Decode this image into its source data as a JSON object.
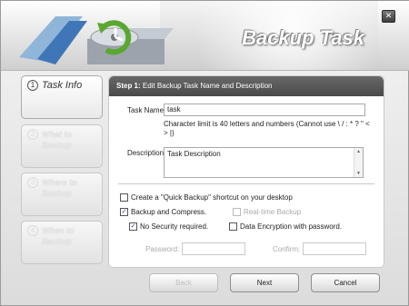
{
  "window": {
    "title": "Backup Task",
    "close_icon": "close-icon"
  },
  "sidebar": {
    "items": [
      {
        "num": "1",
        "label": "Task Info",
        "state": "active"
      },
      {
        "num": "2",
        "label": "What to Backup",
        "state": "inactive"
      },
      {
        "num": "3",
        "label": "Where to Backup",
        "state": "inactive"
      },
      {
        "num": "4",
        "label": "When to Backup",
        "state": "inactive"
      }
    ]
  },
  "step": {
    "title_prefix": "Step 1:",
    "title": "Edit Backup Task Name and Description"
  },
  "form": {
    "task_name_label": "Task Name",
    "task_name_value": "task",
    "char_limit_note": "Character limit is 40 letters and numbers (Cannot use \\ / : * ? \" < > |)",
    "description_label": "Description",
    "description_value": "Task Description",
    "quick_backup": {
      "label": "Create a \"Quick Backup\" shortcut on your desktop",
      "checked": false
    },
    "backup_compress": {
      "label": "Backup and Compress.",
      "checked": true
    },
    "realtime_backup": {
      "label": "Real-time Backup",
      "checked": false,
      "disabled": true
    },
    "no_security": {
      "label": "No Security required.",
      "checked": true
    },
    "data_encryption": {
      "label": "Data Encryption with password.",
      "checked": false
    },
    "password_label": "Password:",
    "confirm_label": "Confirm:"
  },
  "buttons": {
    "back": "Back",
    "next": "Next",
    "cancel": "Cancel"
  },
  "colors": {
    "header_dark": "#555555",
    "accent_green": "#5aa832"
  }
}
